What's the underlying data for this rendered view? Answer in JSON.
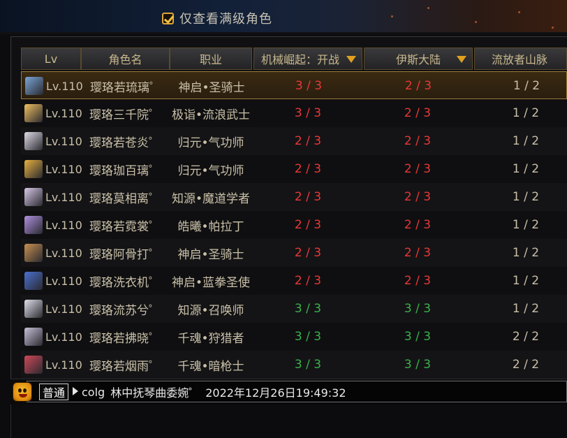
{
  "filter": {
    "checked": true,
    "label": "仅查看满级角色"
  },
  "table": {
    "columns": [
      "Lv",
      "角色名",
      "职业",
      "机械崛起：开战",
      "伊斯大陆",
      "流放者山脉"
    ],
    "rows": [
      {
        "lv": "Lv.110",
        "name": "璎珞若琉璃゜",
        "job": "神启•圣骑士",
        "c1": "3 / 3",
        "c2": "2 / 3",
        "c3": "1 / 2",
        "c1_color": "red",
        "c2_color": "red",
        "c3_color": "white",
        "selected": true,
        "avatar": "#7aa6d8"
      },
      {
        "lv": "Lv.110",
        "name": "璎珞三千院゜",
        "job": "极诣•流浪武士",
        "c1": "3 / 3",
        "c2": "2 / 3",
        "c3": "1 / 2",
        "c1_color": "red",
        "c2_color": "red",
        "c3_color": "white",
        "selected": false,
        "avatar": "#f0c060"
      },
      {
        "lv": "Lv.110",
        "name": "璎珞若苍炎゜",
        "job": "归元•气功师",
        "c1": "2 / 3",
        "c2": "2 / 3",
        "c3": "1 / 2",
        "c1_color": "red",
        "c2_color": "red",
        "c3_color": "white",
        "selected": false,
        "avatar": "#e0dce8"
      },
      {
        "lv": "Lv.110",
        "name": "璎珞珈百璃゜",
        "job": "归元•气功师",
        "c1": "2 / 3",
        "c2": "2 / 3",
        "c3": "1 / 2",
        "c1_color": "red",
        "c2_color": "red",
        "c3_color": "white",
        "selected": false,
        "avatar": "#e8b040"
      },
      {
        "lv": "Lv.110",
        "name": "璎珞莫相离゜",
        "job": "知源•魔道学者",
        "c1": "2 / 3",
        "c2": "2 / 3",
        "c3": "1 / 2",
        "c1_color": "red",
        "c2_color": "red",
        "c3_color": "white",
        "selected": false,
        "avatar": "#d8c8e8"
      },
      {
        "lv": "Lv.110",
        "name": "璎珞若霓裳゜",
        "job": "皓曦•帕拉丁",
        "c1": "2 / 3",
        "c2": "2 / 3",
        "c3": "1 / 2",
        "c1_color": "red",
        "c2_color": "red",
        "c3_color": "white",
        "selected": false,
        "avatar": "#b090e0"
      },
      {
        "lv": "Lv.110",
        "name": "璎珞阿骨打゜",
        "job": "神启•圣骑士",
        "c1": "2 / 3",
        "c2": "2 / 3",
        "c3": "1 / 2",
        "c1_color": "red",
        "c2_color": "red",
        "c3_color": "white",
        "selected": false,
        "avatar": "#c89050"
      },
      {
        "lv": "Lv.110",
        "name": "璎珞洗衣机゜",
        "job": "神启•蓝拳圣使",
        "c1": "2 / 3",
        "c2": "2 / 3",
        "c3": "1 / 2",
        "c1_color": "red",
        "c2_color": "red",
        "c3_color": "white",
        "selected": false,
        "avatar": "#4a70d0"
      },
      {
        "lv": "Lv.110",
        "name": "璎珞流苏兮゜",
        "job": "知源•召唤师",
        "c1": "3 / 3",
        "c2": "3 / 3",
        "c3": "1 / 2",
        "c1_color": "green",
        "c2_color": "green",
        "c3_color": "white",
        "selected": false,
        "avatar": "#e0e0ec"
      },
      {
        "lv": "Lv.110",
        "name": "璎珞若拂晓゜",
        "job": "千魂•狩猎者",
        "c1": "3 / 3",
        "c2": "3 / 3",
        "c3": "2 / 2",
        "c1_color": "green",
        "c2_color": "green",
        "c3_color": "white",
        "selected": false,
        "avatar": "#c8c0d8"
      },
      {
        "lv": "Lv.110",
        "name": "璎珞若烟雨゜",
        "job": "千魂•暗枪士",
        "c1": "3 / 3",
        "c2": "3 / 3",
        "c3": "2 / 2",
        "c1_color": "green",
        "c2_color": "green",
        "c3_color": "white",
        "selected": false,
        "avatar": "#d04858"
      }
    ]
  },
  "chat": {
    "channel": "普通",
    "sender": "colg",
    "message": "林中抚琴曲委婉゜",
    "timestamp": "2022年12月26日19:49:32"
  },
  "colors": {
    "red": "#e83838",
    "green": "#39b24a",
    "accent": "#e0a020"
  },
  "icons": {
    "checkbox": "checkbox-icon",
    "dropdown": "triangle-down-icon",
    "emoji": "smiley-face-icon",
    "channel_arrow": "play-arrow-icon"
  }
}
